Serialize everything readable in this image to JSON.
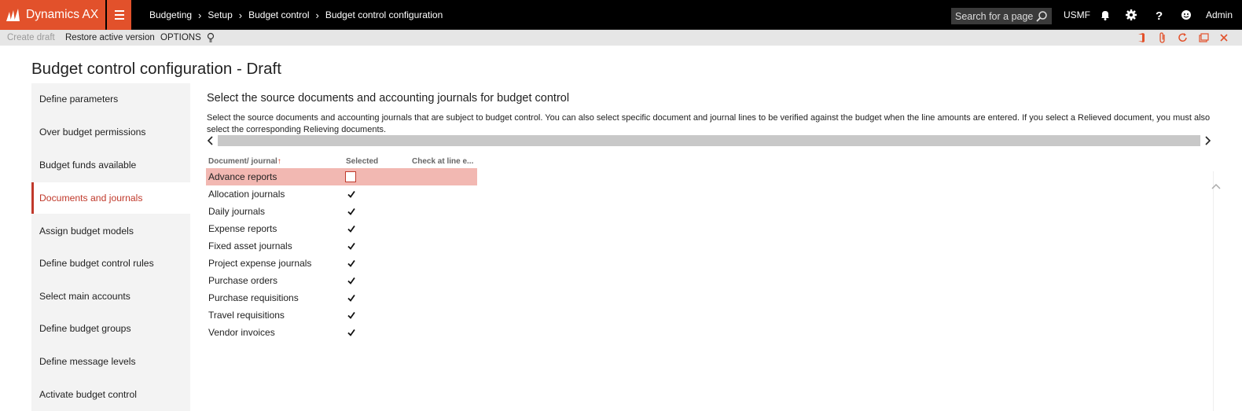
{
  "app": {
    "brand": "Dynamics AX",
    "colors": {
      "brand": "#e2512b",
      "accent": "#c0392b",
      "selected_row": "#f2b8b2"
    }
  },
  "breadcrumb": [
    "Budgeting",
    "Budget control",
    "Budget control configuration"
  ],
  "breadcrumb_setup": "Setup",
  "search": {
    "placeholder": "Search for a page"
  },
  "company": "USMF",
  "user": "Admin",
  "actionbar": {
    "create_draft": "Create draft",
    "restore": "Restore active version",
    "options": "OPTIONS"
  },
  "page_title": "Budget control configuration - Draft",
  "nav": [
    "Define parameters",
    "Over budget permissions",
    "Budget funds available",
    "Documents and journals",
    "Assign budget models",
    "Define budget control rules",
    "Select main accounts",
    "Define budget groups",
    "Define message levels",
    "Activate budget control"
  ],
  "section": {
    "title": "Select the source documents and accounting journals for budget control",
    "description": "Select the source documents and accounting journals that are subject to budget control. You can also select specific document and journal lines to be verified against the budget when the line amounts are entered. If you select a Relieved document, you must also select the corresponding Relieving documents."
  },
  "grid": {
    "headers": {
      "document": "Document/ journal",
      "selected": "Selected",
      "check": "Check at line e..."
    },
    "rows": [
      {
        "label": "Advance reports",
        "selected": false
      },
      {
        "label": "Allocation journals",
        "selected": true
      },
      {
        "label": "Daily journals",
        "selected": true
      },
      {
        "label": "Expense reports",
        "selected": true
      },
      {
        "label": "Fixed asset journals",
        "selected": true
      },
      {
        "label": "Project expense journals",
        "selected": true
      },
      {
        "label": "Purchase orders",
        "selected": true
      },
      {
        "label": "Purchase requisitions",
        "selected": true
      },
      {
        "label": "Travel requisitions",
        "selected": true
      },
      {
        "label": "Vendor invoices",
        "selected": true
      }
    ]
  },
  "icons": [
    "dynamics-logo-icon",
    "hamburger-icon",
    "search-icon",
    "bell-icon",
    "gear-icon",
    "help-icon",
    "smiley-icon",
    "lightbulb-icon",
    "office-icon",
    "attachment-icon",
    "refresh-icon",
    "popout-icon",
    "close-icon",
    "sort-up-icon",
    "checkmark-icon",
    "chevron-left-icon",
    "chevron-right-icon",
    "chevron-up-icon"
  ]
}
